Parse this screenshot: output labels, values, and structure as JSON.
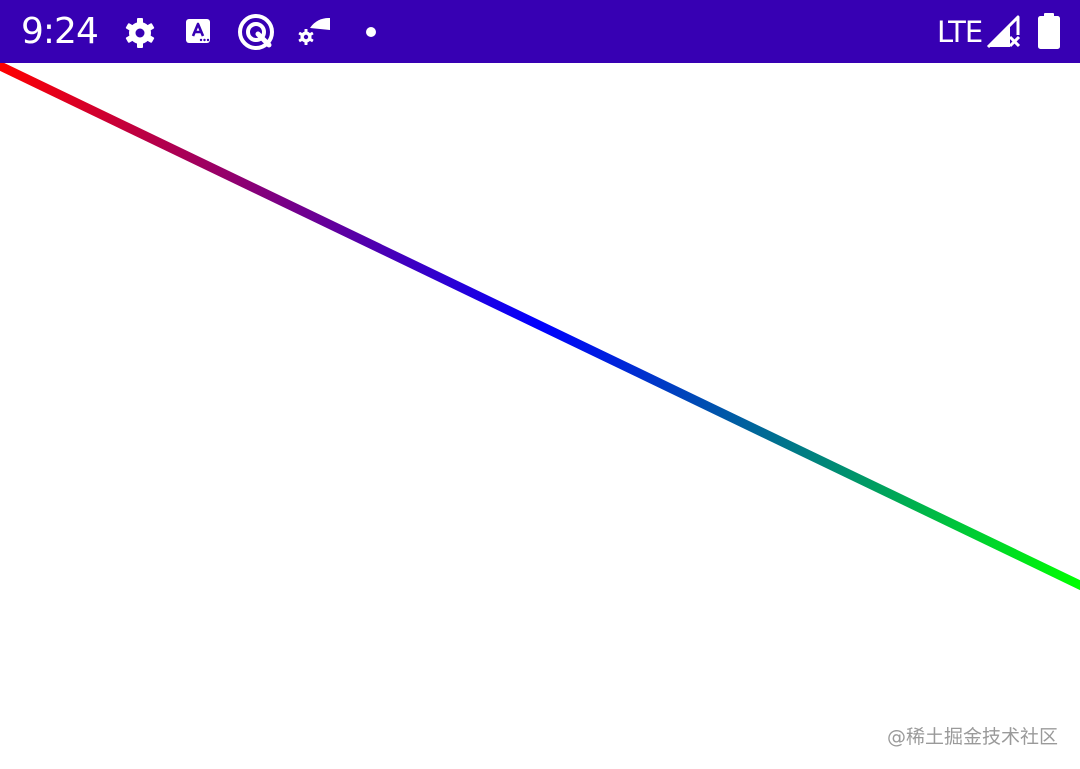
{
  "status_bar": {
    "time": "9:24",
    "network_type": "LTE",
    "background_color": "#3700b3",
    "icons": [
      "settings-icon",
      "accessibility-a-icon",
      "app-q-icon",
      "wifi-settings-icon",
      "notification-dot-icon",
      "signal-no-service-icon",
      "battery-full-icon"
    ]
  },
  "canvas": {
    "gradient_colors": [
      "#ff0000",
      "#0000ff",
      "#00ff00"
    ]
  },
  "watermark": {
    "text": "@稀土掘金技术社区"
  }
}
